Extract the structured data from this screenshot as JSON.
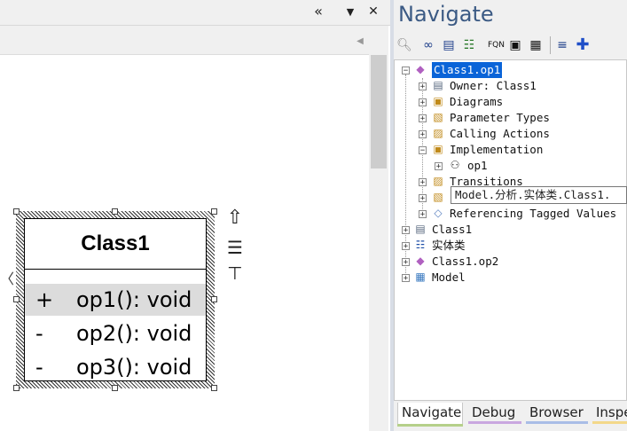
{
  "left_panel": {
    "controls": {
      "collapse_glyph": "«",
      "dropdown_glyph": "▼",
      "close_glyph": "✕"
    },
    "scroll_arrows": {
      "left": "◀",
      "right": "▶"
    },
    "class_element": {
      "name": "Class1",
      "operations": [
        {
          "visibility": "+",
          "signature": "op1(): void",
          "selected": true
        },
        {
          "visibility": "-",
          "signature": "op2(): void",
          "selected": false
        },
        {
          "visibility": "-",
          "signature": "op3(): void",
          "selected": false
        }
      ],
      "quicklinker_glyphs": [
        "⇧",
        "☰",
        "⊤"
      ]
    }
  },
  "navigate": {
    "title": "Navigate",
    "toolbar_icons": [
      "find-icon",
      "glasses-icon",
      "properties-icon",
      "relationship-icon",
      "fqn-icon",
      "id-card-icon",
      "tag-icon",
      "filter-icon",
      "move-icon"
    ],
    "toolbar_labels": {
      "fqn": "FQN"
    },
    "tree": {
      "root": "Class1.op1",
      "children": [
        {
          "label": "Owner: Class1",
          "icon": "owner-icon"
        },
        {
          "label": "Diagrams",
          "icon": "diagram-icon"
        },
        {
          "label": "Parameter Types",
          "icon": "parameter-icon"
        },
        {
          "label": "Calling Actions",
          "icon": "action-icon"
        },
        {
          "label": "Implementation",
          "icon": "implementation-icon",
          "expanded": true,
          "children": [
            {
              "label": "op1",
              "icon": "operation-icon"
            }
          ]
        },
        {
          "label": "Transitions",
          "icon": "transition-icon"
        },
        {
          "label": "",
          "icon": "folder-icon"
        },
        {
          "label": "Referencing Tagged Values",
          "icon": "tagged-value-icon"
        }
      ],
      "siblings": [
        {
          "label": "Class1",
          "icon": "class-icon"
        },
        {
          "label": "实体类",
          "icon": "package-diagram-icon"
        },
        {
          "label": "Class1.op2",
          "icon": "operation-icon"
        },
        {
          "label": "Model",
          "icon": "model-icon"
        }
      ]
    },
    "tooltip": "Model.分析.实体类.Class1.",
    "tabs": [
      {
        "label": "Navigate",
        "active": true,
        "color": "#b5d08a"
      },
      {
        "label": "Debug",
        "active": false,
        "color": "#c9a7e0"
      },
      {
        "label": "Browser",
        "active": false,
        "color": "#a9bde6"
      },
      {
        "label": "Inspe",
        "active": false,
        "color": "#f3d88a"
      }
    ]
  }
}
